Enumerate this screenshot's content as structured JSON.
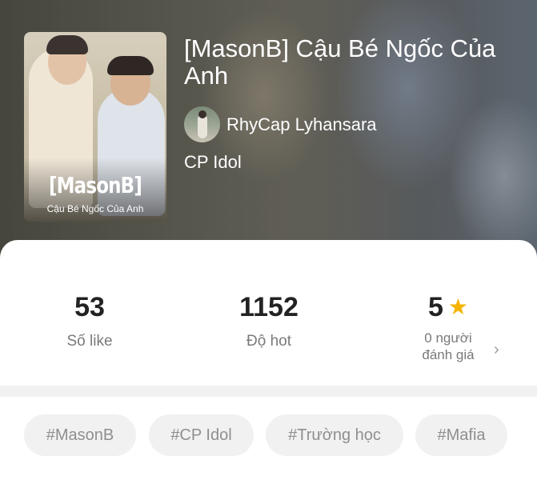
{
  "story": {
    "title": "[MasonB] Cậu Bé Ngốc Của Anh",
    "author": "RhyCap Lyhansara",
    "category": "CP Idol",
    "cover": {
      "title": "[MasonB]",
      "subtitle": "Cậu Bé Ngốc Của Anh"
    }
  },
  "stats": {
    "likes": {
      "value": "53",
      "label": "Số like"
    },
    "hot": {
      "value": "1152",
      "label": "Độ hot"
    },
    "rating": {
      "value": "5",
      "icon": "star-icon",
      "label_line1": "0 người",
      "label_line2": "đánh giá"
    }
  },
  "tags": [
    "#MasonB",
    "#CP Idol",
    "#Trường học",
    "#Mafia"
  ],
  "colors": {
    "star": "#f5b301",
    "tag_bg": "#f1f1f1",
    "tag_text": "#8f8f8f"
  }
}
